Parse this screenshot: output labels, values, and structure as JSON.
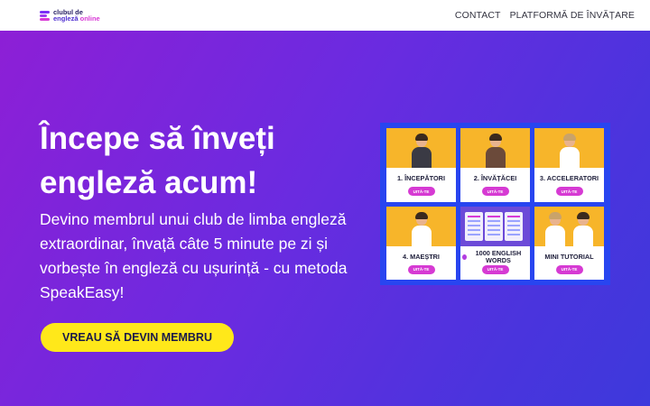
{
  "logo": {
    "line1": "clubul de",
    "line2_a": "engleză",
    "line2_b": "online"
  },
  "nav": {
    "items": [
      "CONTACT",
      "PLATFORMĂ DE ÎNVĂȚARE"
    ]
  },
  "hero": {
    "headline": "Începe să înveți engleză acum!",
    "subtext": "Devino membrul unui club de limba engleză extraordinar, învață câte 5 minute pe zi și vorbește în engleză cu ușurință - cu metoda SpeakEasy!",
    "cta_label": "VREAU SĂ DEVIN MEMBRU"
  },
  "grid": {
    "colors": {
      "frame": "#2845f0",
      "photo_bg": "#f7b52a",
      "button": "#d63ad3"
    },
    "cards": [
      {
        "title": "1. ÎNCEPĂTORI",
        "button": "UITĂ-TE"
      },
      {
        "title": "2. ÎNVĂȚĂCEI",
        "button": "UITĂ-TE"
      },
      {
        "title": "3. ACCELERATORI",
        "button": "UITĂ-TE"
      },
      {
        "title": "4. MAEȘTRI",
        "button": "UITĂ-TE"
      },
      {
        "title": "1000 ENGLISH WORDS",
        "button": "UITĂ-TE"
      },
      {
        "title": "MINI TUTORIAL",
        "button": "UITĂ-TE"
      }
    ]
  },
  "colors": {
    "cta_bg": "#ffe81a",
    "hero_start": "#8d1fd6",
    "hero_end": "#3d39dc"
  }
}
